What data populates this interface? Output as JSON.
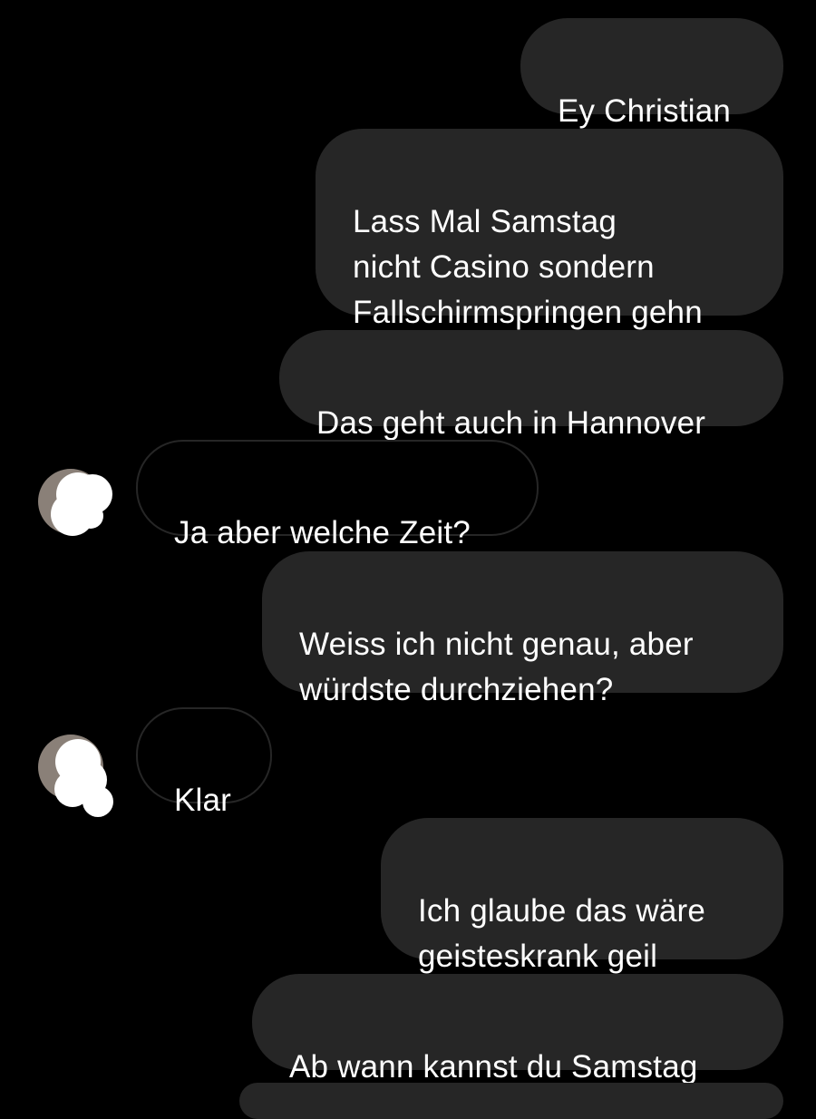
{
  "conversation": {
    "messages": [
      {
        "sender": "me",
        "text": "Ey Christian"
      },
      {
        "sender": "me",
        "text": "Lass Mal Samstag\nnicht Casino sondern\nFallschirmspringen gehn"
      },
      {
        "sender": "me",
        "text": "Das geht auch in Hannover"
      },
      {
        "sender": "other",
        "text": "Ja aber welche Zeit?"
      },
      {
        "sender": "me",
        "text": "Weiss ich nicht genau, aber\nwürdste durchziehen?"
      },
      {
        "sender": "other",
        "text": "Klar"
      },
      {
        "sender": "me",
        "text": "Ich glaube das wäre\ngeisteskrank geil"
      },
      {
        "sender": "me",
        "text": "Ab wann kannst du Samstag"
      }
    ]
  },
  "colors": {
    "background": "#000000",
    "outgoing_bubble": "#262626",
    "incoming_border": "#262626",
    "text": "#ffffff"
  },
  "icons": {
    "avatar": "redacted-avatar-icon"
  }
}
